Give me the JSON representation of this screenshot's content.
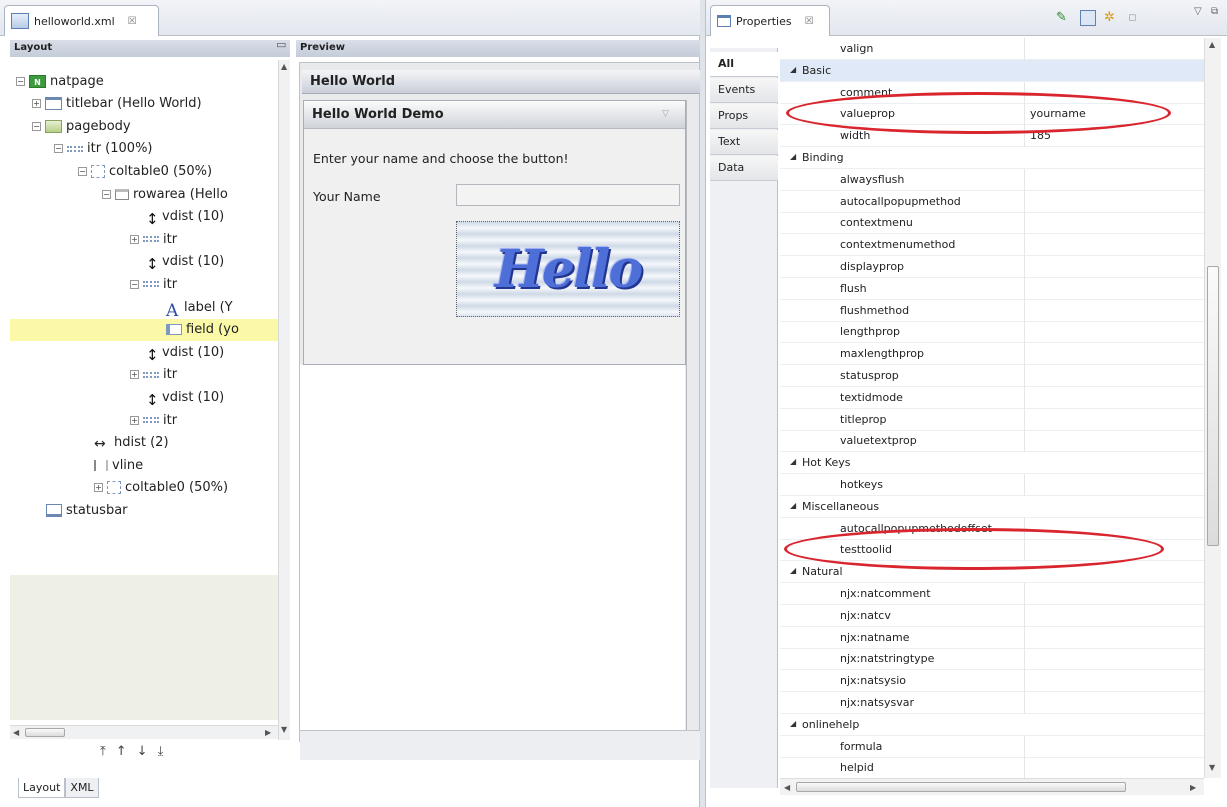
{
  "editor": {
    "tab_title": "helloworld.xml",
    "tab_close": "☒",
    "layout_header": "Layout",
    "preview_header": "Preview",
    "tree": [
      {
        "label": "natpage",
        "icon": "natpage-icon",
        "exp": "⊟"
      },
      {
        "label": "titlebar (Hello World)",
        "icon": "titlebar-icon",
        "exp": "⊞"
      },
      {
        "label": "pagebody",
        "icon": "pagebody-icon",
        "exp": "⊟"
      },
      {
        "label": "itr (100%)",
        "icon": "itr-icon",
        "exp": "⊟"
      },
      {
        "label": "coltable0 (50%)",
        "icon": "coltable-icon",
        "exp": "⊟"
      },
      {
        "label": "rowarea (Hello",
        "icon": "rowarea-icon",
        "exp": "⊟"
      },
      {
        "label": "vdist (10)",
        "icon": "vdist-icon",
        "exp": ""
      },
      {
        "label": "itr",
        "icon": "itr-icon",
        "exp": "⊞"
      },
      {
        "label": "vdist (10)",
        "icon": "vdist-icon",
        "exp": ""
      },
      {
        "label": "itr",
        "icon": "itr-icon",
        "exp": "⊟"
      },
      {
        "label": "label (Y",
        "icon": "label-icon",
        "exp": ""
      },
      {
        "label": "field (yo",
        "icon": "field-icon",
        "exp": ""
      },
      {
        "label": "vdist (10)",
        "icon": "vdist-icon",
        "exp": ""
      },
      {
        "label": "itr",
        "icon": "itr-icon",
        "exp": "⊞"
      },
      {
        "label": "vdist (10)",
        "icon": "vdist-icon",
        "exp": ""
      },
      {
        "label": "itr",
        "icon": "itr-icon",
        "exp": "⊞"
      },
      {
        "label": "hdist (2)",
        "icon": "hdist-icon",
        "exp": ""
      },
      {
        "label": "vline",
        "icon": "vline-icon",
        "exp": ""
      },
      {
        "label": "coltable0 (50%)",
        "icon": "coltable-icon",
        "exp": "⊞"
      },
      {
        "label": "statusbar",
        "icon": "statusbar-icon",
        "exp": ""
      }
    ],
    "bottom_tabs": [
      "Layout",
      "XML"
    ]
  },
  "preview": {
    "title_bar": "Hello World",
    "box_title": "Hello World Demo",
    "instruction": "Enter your name and choose the button!",
    "name_label": "Your Name",
    "name_value": "",
    "button_text": "Hello"
  },
  "properties": {
    "tab_title": "Properties",
    "tab_close": "☒",
    "categories": [
      "All",
      "Events",
      "Props",
      "Text",
      "Data"
    ],
    "rows": [
      {
        "type": "prop",
        "name": "valign",
        "value": ""
      },
      {
        "type": "cat",
        "name": "Basic"
      },
      {
        "type": "prop",
        "name": "comment",
        "value": ""
      },
      {
        "type": "prop",
        "name": "valueprop",
        "value": "yourname"
      },
      {
        "type": "prop",
        "name": "width",
        "value": "185"
      },
      {
        "type": "cat",
        "name": "Binding"
      },
      {
        "type": "prop",
        "name": "alwaysflush",
        "value": ""
      },
      {
        "type": "prop",
        "name": "autocallpopupmethod",
        "value": ""
      },
      {
        "type": "prop",
        "name": "contextmenu",
        "value": ""
      },
      {
        "type": "prop",
        "name": "contextmenumethod",
        "value": ""
      },
      {
        "type": "prop",
        "name": "displayprop",
        "value": ""
      },
      {
        "type": "prop",
        "name": "flush",
        "value": ""
      },
      {
        "type": "prop",
        "name": "flushmethod",
        "value": ""
      },
      {
        "type": "prop",
        "name": "lengthprop",
        "value": ""
      },
      {
        "type": "prop",
        "name": "maxlengthprop",
        "value": ""
      },
      {
        "type": "prop",
        "name": "statusprop",
        "value": ""
      },
      {
        "type": "prop",
        "name": "textidmode",
        "value": ""
      },
      {
        "type": "prop",
        "name": "titleprop",
        "value": ""
      },
      {
        "type": "prop",
        "name": "valuetextprop",
        "value": ""
      },
      {
        "type": "cat",
        "name": "Hot Keys"
      },
      {
        "type": "prop",
        "name": "hotkeys",
        "value": ""
      },
      {
        "type": "cat",
        "name": "Miscellaneous"
      },
      {
        "type": "prop",
        "name": "autocallpopupmethodoffset",
        "value": ""
      },
      {
        "type": "prop",
        "name": "testtoolid",
        "value": ""
      },
      {
        "type": "cat",
        "name": "Natural"
      },
      {
        "type": "prop",
        "name": "njx:natcomment",
        "value": ""
      },
      {
        "type": "prop",
        "name": "njx:natcv",
        "value": ""
      },
      {
        "type": "prop",
        "name": "njx:natname",
        "value": ""
      },
      {
        "type": "prop",
        "name": "njx:natstringtype",
        "value": ""
      },
      {
        "type": "prop",
        "name": "njx:natsysio",
        "value": ""
      },
      {
        "type": "prop",
        "name": "njx:natsysvar",
        "value": ""
      },
      {
        "type": "cat",
        "name": "onlinehelp"
      },
      {
        "type": "prop",
        "name": "formula",
        "value": ""
      },
      {
        "type": "prop",
        "name": "helpid",
        "value": ""
      }
    ]
  },
  "colors": {
    "highlight_ellipse": "#d9262e",
    "selected_row": "#fbf8a7",
    "header_gradient": "#c4ccd9"
  }
}
